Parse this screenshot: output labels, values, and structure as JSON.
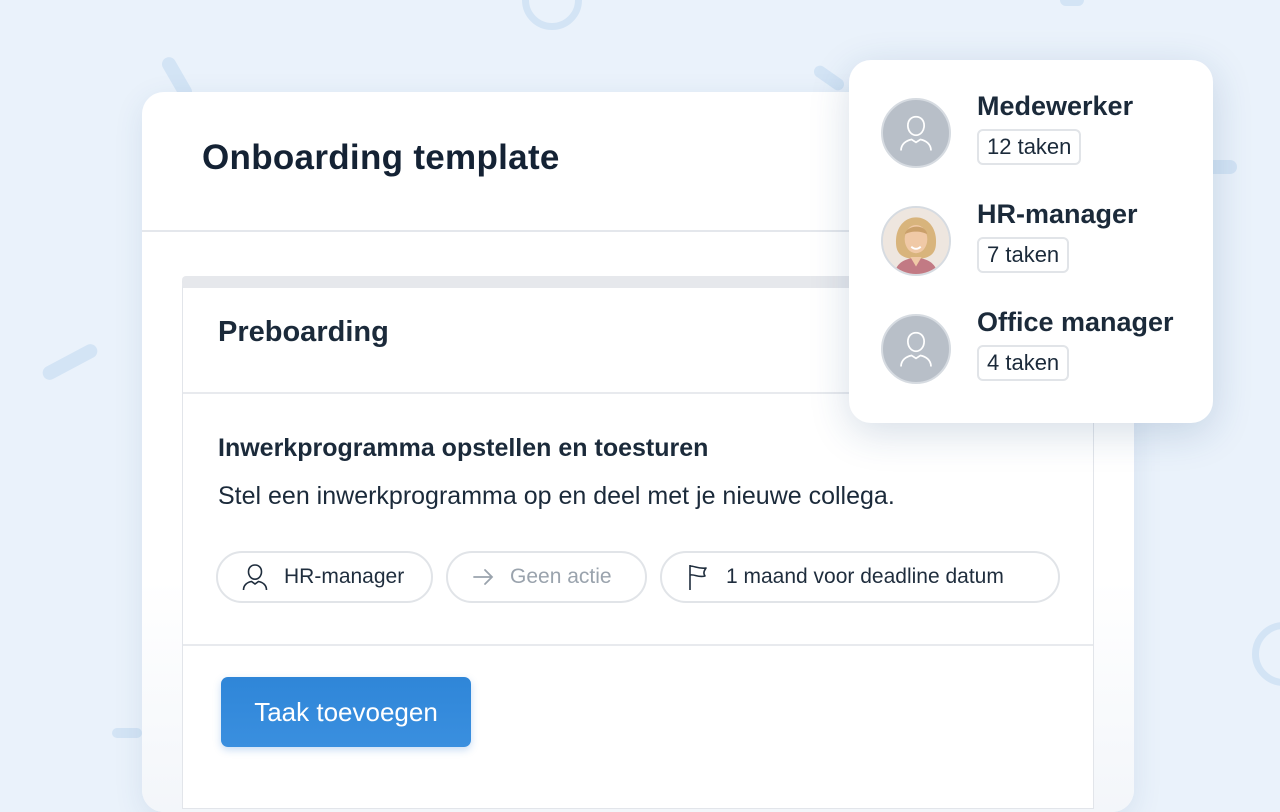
{
  "colors": {
    "background": "#eaf2fb",
    "accent": "#2f86d8",
    "text": "#1b2a3a",
    "muted": "#9aa3ad"
  },
  "page": {
    "title": "Onboarding template"
  },
  "section": {
    "title": "Preboarding",
    "task": {
      "title": "Inwerkprogramma opstellen en toesturen",
      "description": "Stel een inwerkprogramma op en deel met je nieuwe collega.",
      "chips": [
        {
          "icon": "person-icon",
          "label": "HR-manager"
        },
        {
          "icon": "arrow-right-icon",
          "label": "Geen actie"
        },
        {
          "icon": "flag-icon",
          "label": "1 maand voor deadline datum"
        }
      ]
    },
    "add_button_label": "Taak toevoegen"
  },
  "roles": [
    {
      "name": "Medewerker",
      "count": "12 taken",
      "avatar": "person-icon"
    },
    {
      "name": "HR-manager",
      "count": "7 taken",
      "avatar": "photo"
    },
    {
      "name": "Office manager",
      "count": "4 taken",
      "avatar": "person-icon"
    }
  ]
}
